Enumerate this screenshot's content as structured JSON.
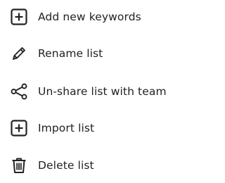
{
  "menu": {
    "items": [
      {
        "label": "Add new keywords",
        "icon": "plus-square-icon"
      },
      {
        "label": "Rename list",
        "icon": "pencil-icon"
      },
      {
        "label": "Un-share list with team",
        "icon": "share-icon"
      },
      {
        "label": "Import list",
        "icon": "plus-square-icon"
      },
      {
        "label": "Delete list",
        "icon": "trash-icon"
      }
    ]
  },
  "colors": {
    "text": "#222222",
    "icon": "#222222",
    "background": "#ffffff"
  }
}
